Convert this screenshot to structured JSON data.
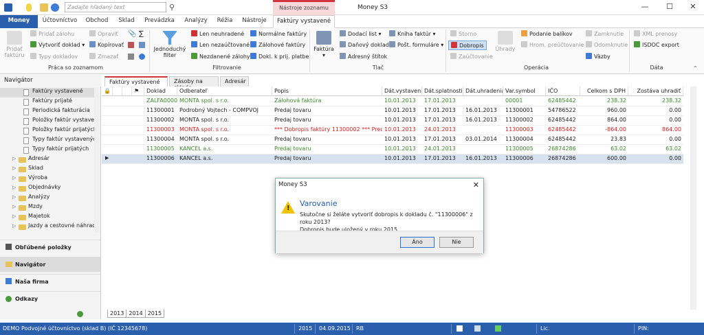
{
  "search": {
    "placeholder": "Zadajte hľadaný text"
  },
  "titlebar": {
    "context_title": "Nástroje zoznamu",
    "app_title": "Money S3",
    "minimize": "—",
    "maximize": "☐",
    "close": "✕"
  },
  "tabs": [
    "Money",
    "Účtovníctvo",
    "Obchod",
    "Sklad",
    "Prevádzka",
    "Analýzy",
    "Réžia",
    "Nástroje",
    "Faktúry vystavené"
  ],
  "ribbon": {
    "pridat_fakturu": "Pridať faktúru",
    "pridat_zalohu": "Pridať zálohu",
    "vytvorit_doklad": "Vytvoriť doklad",
    "typy_dokladov": "Typy dokladov",
    "opravit": "Opraviť",
    "kopirovat": "Kopírovať",
    "zmazat": "Zmazať",
    "grp_praca": "Práca so zoznamom",
    "jednoduchy_filter": "Jednoduchý filter",
    "len_neuhradene": "Len neuhradené",
    "len_nezauctovane": "Len nezaúčtované",
    "nezdanene_zalohy": "Nezdanené zálohy",
    "normalne_faktury": "Normálne faktúry",
    "zalohove_faktury": "Zálohové faktúry",
    "dokl_k_prij_platbe": "Dokl. k prij. platbe",
    "grp_filtrovanie": "Filtrovanie",
    "faktura": "Faktúra",
    "dodaci_list": "Dodací list",
    "danovy_doklad": "Daňový doklad",
    "adresny_stitok": "Adresný štítok",
    "kniha_faktur": "Kniha faktúr",
    "post_formulare": "Pošt. formuláre",
    "grp_tlac": "Tlač",
    "storno": "Storno",
    "dobropis": "Dobropis",
    "zauctovanie": "Zaúčtovanie",
    "uhrady": "Úhrady",
    "podanie_balikov": "Podanie balíkov",
    "hrom_preuctovanie": "Hrom. preúčtovanie",
    "zamknutie": "Zamknutie",
    "odomknutie": "Odomknutie",
    "vazby": "Väzby",
    "grp_operacia": "Operácia",
    "xml_prenosy": "XML prenosy",
    "isdoc_export": "ISDOC export",
    "grp_data": "Dáta"
  },
  "navigator": {
    "title": "Navigátor",
    "items": [
      "Faktúry vystavené",
      "Faktúry prijaté",
      "Periodická fakturácia",
      "Položky faktúr vystavených",
      "Položky faktúr prijatých",
      "Typy faktúr vystavených",
      "Typy faktúr prijatých"
    ],
    "folders": [
      "Adresár",
      "Sklad",
      "Výroba",
      "Objednávky",
      "Analýzy",
      "Mzdy",
      "Majetok",
      "Jazdy a cestovné náhrady"
    ],
    "bottom": [
      "Obľúbené položky",
      "Navigátor",
      "Naša firma",
      "Odkazy"
    ]
  },
  "doc_tabs": [
    "Faktúry vystavené",
    "Zásoby na sklade",
    "Adresár"
  ],
  "table": {
    "columns": [
      "Doklad",
      "Odberateľ",
      "Popis",
      "Dát.vystavenia",
      "Dát.splatnosti",
      "Dát.uhradenia",
      "Var.symbol",
      "IČO",
      "Celkom s DPH",
      "Zostáva uhradiť"
    ],
    "rows": [
      {
        "doklad": "ZALFA00001",
        "odb": "MONTA spol. s r.o.",
        "popis": "Zálohová faktúra",
        "vyst": "10.01.2013",
        "spl": "17.01.2013",
        "uhr": "",
        "vs": "00001",
        "ico": "62485442",
        "celk": "238.32",
        "zost": "238.32",
        "color": "#3a8a2a"
      },
      {
        "doklad": "11300001",
        "odb": "Podrobný Vojtech - COMPVOJ",
        "popis": "Predaj tovaru",
        "vyst": "10.01.2013",
        "spl": "17.01.2013",
        "uhr": "16.01.2013",
        "vs": "11300001",
        "ico": "54786522",
        "celk": "960.00",
        "zost": "0.00",
        "color": "#222"
      },
      {
        "doklad": "11300002",
        "odb": "MONTA spol. s r.o.",
        "popis": "Predaj tovaru",
        "vyst": "10.01.2013",
        "spl": "17.01.2013",
        "uhr": "16.01.2013",
        "vs": "11300002",
        "ico": "62485442",
        "celk": "864.00",
        "zost": "0.00",
        "color": "#222"
      },
      {
        "doklad": "11300003",
        "odb": "MONTA spol. s r.o.",
        "popis": "*** Dobropis faktúry 11300002 *** Preda",
        "vyst": "10.01.2013",
        "spl": "24.01.2013",
        "uhr": "",
        "vs": "11300003",
        "ico": "62485442",
        "celk": "-864.00",
        "zost": "864.00",
        "color": "#d42020"
      },
      {
        "doklad": "11300004",
        "odb": "MONTA spol. s r.o.",
        "popis": "Predaj tovaru",
        "vyst": "10.01.2013",
        "spl": "17.01.2013",
        "uhr": "03.01.2014",
        "vs": "11300004",
        "ico": "62485442",
        "celk": "23.83",
        "zost": "0.00",
        "color": "#222"
      },
      {
        "doklad": "11300005",
        "odb": "KANCEL a.s.",
        "popis": "Predaj tovaru",
        "vyst": "10.01.2013",
        "spl": "24.01.2013",
        "uhr": "",
        "vs": "11300005",
        "ico": "26874286",
        "celk": "63.02",
        "zost": "63.02",
        "color": "#3a8a2a"
      },
      {
        "doklad": "11300006",
        "odb": "KANCEL a.s.",
        "popis": "Predaj tovaru",
        "vyst": "10.01.2013",
        "spl": "17.01.2013",
        "uhr": "16.01.2013",
        "vs": "11300006",
        "ico": "26874286",
        "celk": "600.00",
        "zost": "0.00",
        "color": "#222"
      }
    ]
  },
  "year_tabs": [
    "2013",
    "2014",
    "2015"
  ],
  "dialog": {
    "title": "Money S3",
    "heading": "Varovanie",
    "line1": "Skutočne si želáte vytvoriť dobropis k dokladu č. \"11300006\" z roku 2013?",
    "line2": "Dobropis bude uložený v roku 2015.",
    "yes": "Áno",
    "no": "Nie"
  },
  "status": {
    "company": "DEMO Podvojné účtovníctvo (sklad B) (IČ 12345678)",
    "year": "2015",
    "date": "04.09.2015",
    "user": "RB",
    "lic": "Lic:",
    "pin": "PIN:"
  },
  "colors": {
    "brand": "#2a5fad",
    "accent": "#d0343e"
  }
}
